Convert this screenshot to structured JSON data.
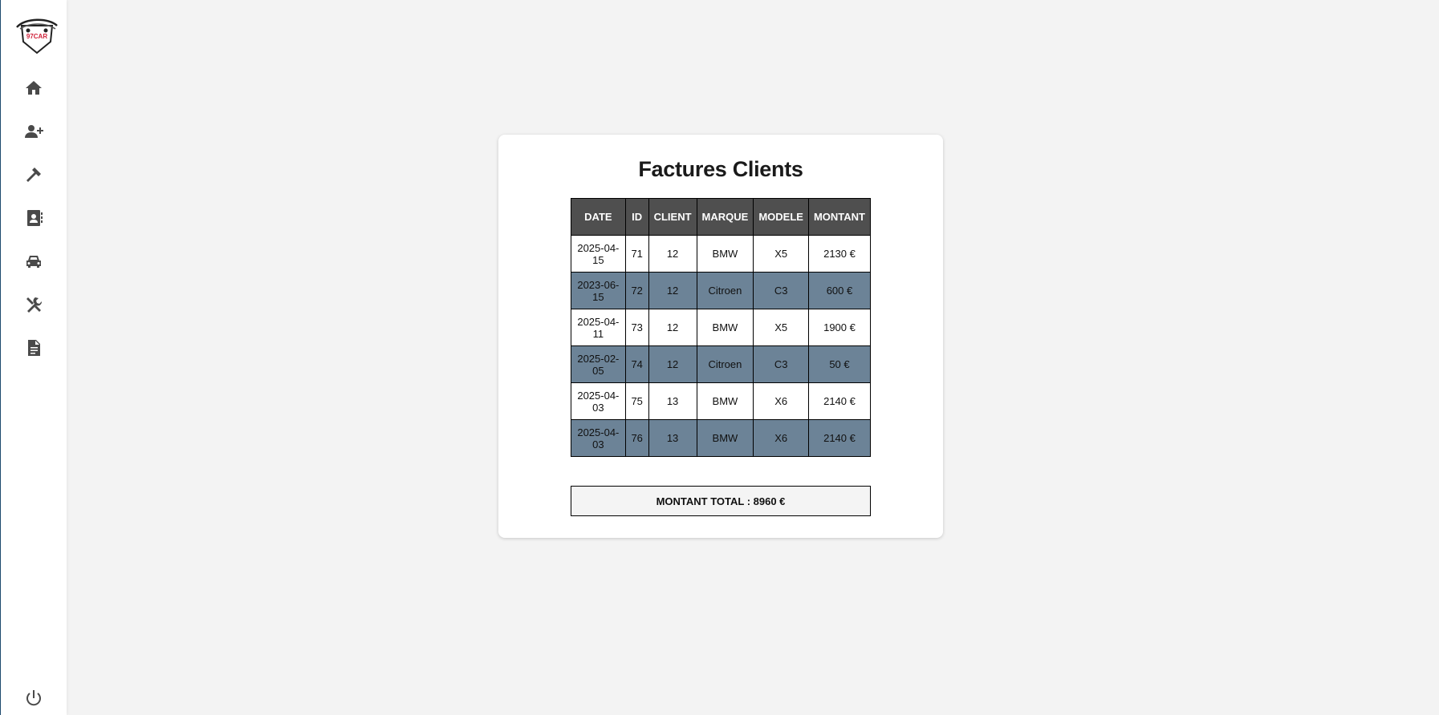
{
  "sidebar": {
    "logo_text": "97CAR",
    "items": [
      {
        "icon": "home-icon"
      },
      {
        "icon": "user-add-icon"
      },
      {
        "icon": "hammer-icon"
      },
      {
        "icon": "contacts-icon"
      },
      {
        "icon": "car-icon"
      },
      {
        "icon": "tools-icon"
      },
      {
        "icon": "invoice-icon"
      }
    ],
    "logout_icon": "power-icon"
  },
  "page": {
    "title": "Factures Clients"
  },
  "table": {
    "headers": [
      "DATE",
      "ID",
      "CLIENT",
      "MARQUE",
      "MODELE",
      "MONTANT"
    ],
    "rows": [
      [
        "2025-04-15",
        "71",
        "12",
        "BMW",
        "X5",
        "2130 €"
      ],
      [
        "2023-06-15",
        "72",
        "12",
        "Citroen",
        "C3",
        "600 €"
      ],
      [
        "2025-04-11",
        "73",
        "12",
        "BMW",
        "X5",
        "1900 €"
      ],
      [
        "2025-02-05",
        "74",
        "12",
        "Citroen",
        "C3",
        "50 €"
      ],
      [
        "2025-04-03",
        "75",
        "13",
        "BMW",
        "X6",
        "2140 €"
      ],
      [
        "2025-04-03",
        "76",
        "13",
        "BMW",
        "X6",
        "2140 €"
      ]
    ]
  },
  "total": {
    "label": "MONTANT TOTAL : 8960 €"
  },
  "colors": {
    "header_bg": "#4f4f4f",
    "alt_row_bg": "#6c8397",
    "logo_accent": "#d0233b"
  }
}
